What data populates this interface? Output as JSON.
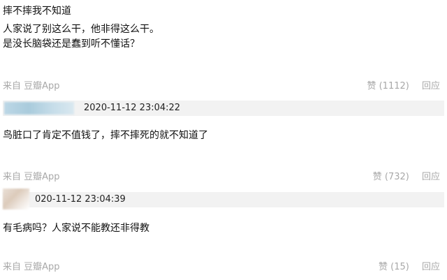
{
  "comments": [
    {
      "lines": [
        "摔不摔我不知道",
        "人家说了别这么干，他非得这么干。",
        "是没长脑袋还是蠢到听不懂话？"
      ],
      "from": "来自 豆瓣App",
      "like": "赞 (1112)",
      "reply": "回应"
    },
    {
      "time": "2020-11-12 23:04:22",
      "lines": [
        "鸟脏口了肯定不值钱了，摔不摔死的就不知道了"
      ],
      "from": "来自 豆瓣App",
      "like": "赞 (732)",
      "reply": "回应"
    },
    {
      "time": "020-11-12 23:04:39",
      "lines": [
        "有毛病吗？人家说不能教还非得教"
      ],
      "from": "来自 豆瓣App",
      "like": "赞 (15)",
      "reply": "回应"
    }
  ]
}
